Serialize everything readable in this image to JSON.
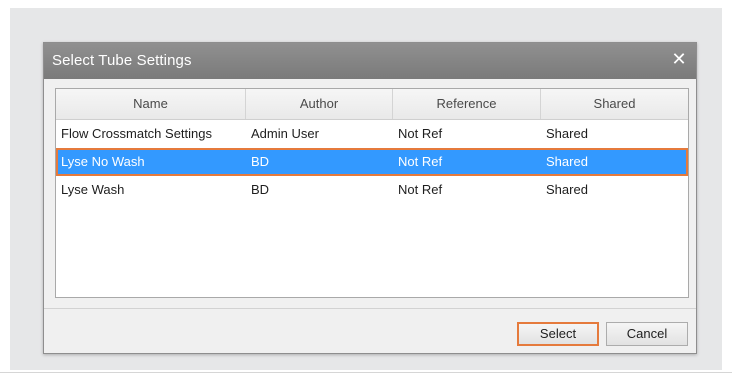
{
  "dialog": {
    "title": "Select Tube Settings",
    "close_glyph": "✕",
    "close_icon": "close-icon"
  },
  "grid": {
    "columns": [
      "Name",
      "Author",
      "Reference",
      "Shared"
    ],
    "rows": [
      {
        "name": "Flow Crossmatch Settings",
        "author": "Admin User",
        "reference": "Not Ref",
        "shared": "Shared",
        "selected": false
      },
      {
        "name": "Lyse No Wash",
        "author": "BD",
        "reference": "Not Ref",
        "shared": "Shared",
        "selected": true
      },
      {
        "name": "Lyse Wash",
        "author": "BD",
        "reference": "Not Ref",
        "shared": "Shared",
        "selected": false
      }
    ]
  },
  "buttons": {
    "select_label": "Select",
    "cancel_label": "Cancel"
  },
  "colors": {
    "selection": "#3399ff",
    "highlight_outline": "#e57a3c",
    "titlebar": "#808080"
  }
}
